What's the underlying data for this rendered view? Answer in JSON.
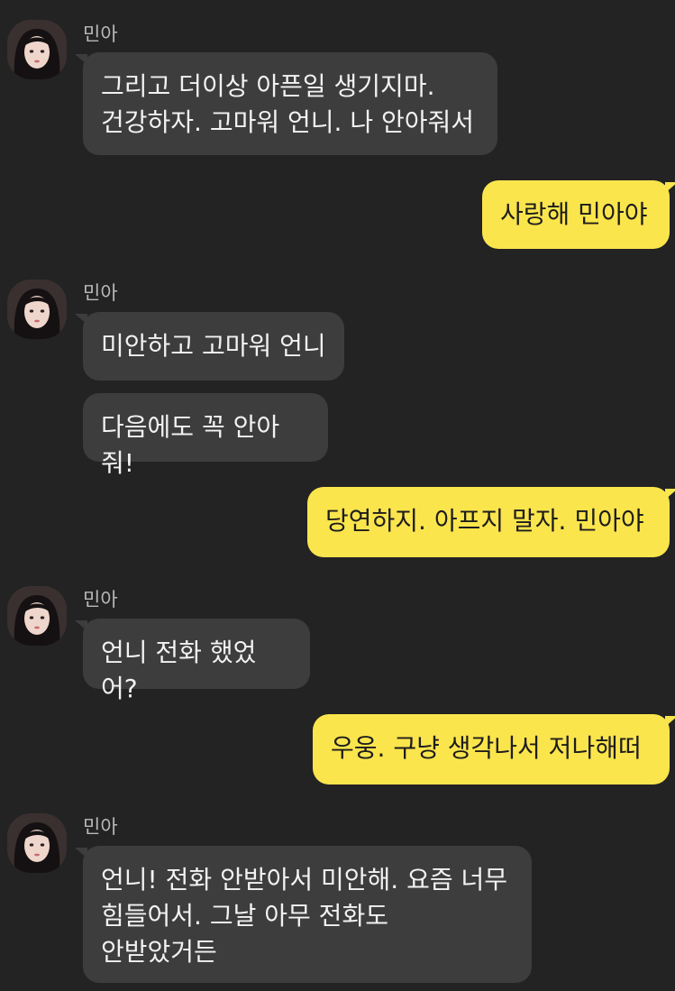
{
  "sender_name": "민아",
  "messages": [
    {
      "from": "them",
      "text": "그리고 더이상 아픈일 생기지마.\n건강하자. 고마워 언니. 나 안아줘서"
    },
    {
      "from": "me",
      "text": "사랑해 민아야"
    },
    {
      "from": "them",
      "text": "미안하고 고마워 언니"
    },
    {
      "from": "them",
      "text": "다음에도 꼭 안아줘!"
    },
    {
      "from": "me",
      "text": "당연하지. 아프지 말자. 민아야"
    },
    {
      "from": "them",
      "text": "언니 전화 했었어?"
    },
    {
      "from": "me",
      "text": "우웅. 구냥 생각나서 저나해떠"
    },
    {
      "from": "them",
      "text": "언니! 전화 안받아서 미안해. 요즘 너무\n힘들어서. 그날 아무 전화도\n안받았거든"
    }
  ],
  "colors": {
    "background": "#232323",
    "incoming_bubble": "#3d3d3d",
    "outgoing_bubble": "#fbe54d"
  }
}
